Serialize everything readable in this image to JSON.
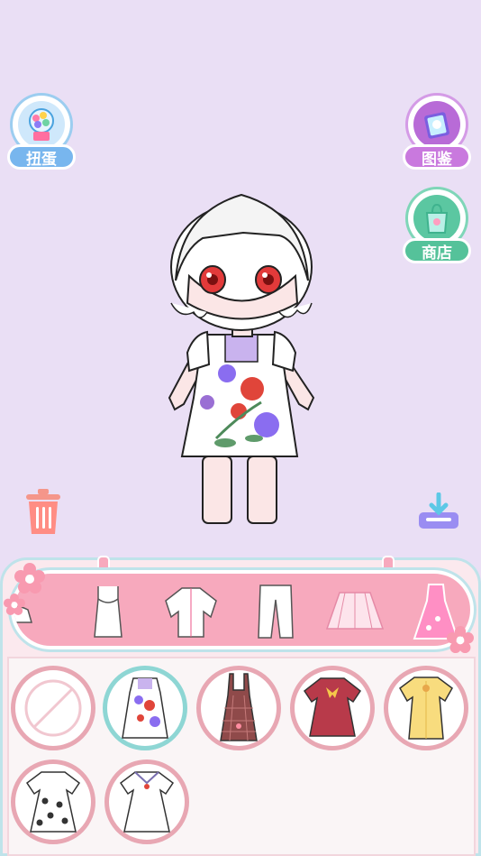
{
  "sidebar": {
    "gacha_label": "扭蛋",
    "album_label": "图鉴",
    "shop_label": "商店"
  },
  "wardrobe": {
    "category_tabs": [
      "shoes-icon",
      "tank-top-icon",
      "shirt-icon",
      "pants-icon",
      "skirt-icon",
      "dress-icon"
    ],
    "items": [
      {
        "icon": "none-icon",
        "selected": false
      },
      {
        "icon": "floral-dress-icon",
        "selected": true
      },
      {
        "icon": "plaid-pinafore-icon",
        "selected": false
      },
      {
        "icon": "red-ruffle-dress-icon",
        "selected": false
      },
      {
        "icon": "yellow-dress-icon",
        "selected": false
      },
      {
        "icon": "polka-dot-dress-icon",
        "selected": false
      },
      {
        "icon": "white-sailor-dress-icon",
        "selected": false
      }
    ]
  },
  "colors": {
    "background": "#eadff5",
    "panel_pink": "#f7a9bd",
    "slot_border": "#e8a7b3",
    "selected_border": "#8ed6d4"
  }
}
